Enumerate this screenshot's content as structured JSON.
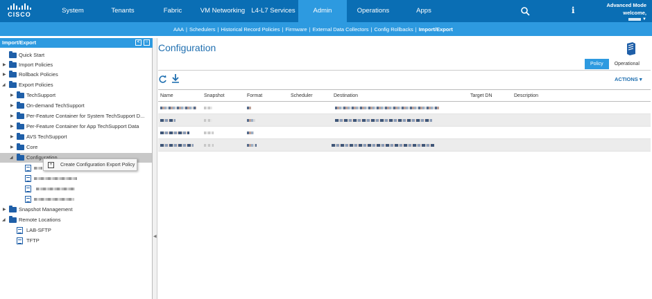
{
  "brand": {
    "logo_text": "CISCO"
  },
  "topnav": {
    "items": [
      {
        "label": "System"
      },
      {
        "label": "Tenants"
      },
      {
        "label": "Fabric"
      },
      {
        "label": "VM Networking"
      },
      {
        "label": "L4-L7 Services"
      },
      {
        "label": "Admin"
      },
      {
        "label": "Operations"
      },
      {
        "label": "Apps"
      }
    ],
    "active": "Admin",
    "mode_label": "Advanced Mode",
    "welcome_label": "welcome,"
  },
  "subnav": {
    "items": [
      {
        "label": "AAA"
      },
      {
        "label": "Schedulers"
      },
      {
        "label": "Historical Record Policies"
      },
      {
        "label": "Firmware"
      },
      {
        "label": "External Data Collectors"
      },
      {
        "label": "Config Rollbacks"
      },
      {
        "label": "Import/Export"
      }
    ],
    "separator": "|",
    "active": "Import/Export"
  },
  "left_panel": {
    "title": "Import/Export",
    "tree": [
      {
        "label": "Quick Start"
      },
      {
        "label": "Import Policies"
      },
      {
        "label": "Rollback Policies"
      },
      {
        "label": "Export Policies"
      },
      {
        "label": "TechSupport"
      },
      {
        "label": "On-demand TechSupport"
      },
      {
        "label": "Per-Feature Container for System TechSupport D..."
      },
      {
        "label": "Per-Feature Container for App TechSupport Data"
      },
      {
        "label": "AVS TechSupport"
      },
      {
        "label": "Core"
      },
      {
        "label": "Configuration"
      },
      {
        "label": "Snapshot Management"
      },
      {
        "label": "Remote Locations"
      },
      {
        "label": "LAB-SFTP"
      },
      {
        "label": "TFTP"
      }
    ],
    "context_menu": {
      "label": "Create Configuration Export Policy"
    }
  },
  "main": {
    "title": "Configuration",
    "tabs": [
      {
        "label": "Policy"
      },
      {
        "label": "Operational"
      }
    ],
    "active_tab": "Policy",
    "actions_label": "ACTIONS",
    "table": {
      "columns": [
        "Name",
        "Snapshot",
        "Format",
        "Scheduler",
        "Destination",
        "Target DN",
        "Description"
      ]
    }
  },
  "colors": {
    "topnav_bg": "#0a6eb4",
    "accent": "#2d9ae0",
    "folder": "#1f5fa8",
    "title": "#1f6fb0"
  }
}
